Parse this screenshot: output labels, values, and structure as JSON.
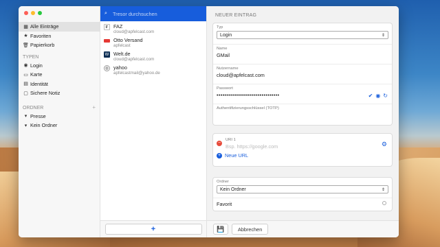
{
  "sidebar": {
    "main": [
      {
        "label": "Alle Einträge",
        "icon": "grid-icon"
      },
      {
        "label": "Favoriten",
        "icon": "star-icon"
      },
      {
        "label": "Papierkorb",
        "icon": "trash-icon"
      }
    ],
    "types_heading": "TYPEN",
    "types": [
      {
        "label": "Login",
        "icon": "globe-icon"
      },
      {
        "label": "Karte",
        "icon": "credit-card-icon"
      },
      {
        "label": "Identität",
        "icon": "id-card-icon"
      },
      {
        "label": "Sichere Notiz",
        "icon": "note-icon"
      }
    ],
    "folders_heading": "ORDNER",
    "folders": [
      {
        "label": "Presse"
      },
      {
        "label": "Kein Ordner"
      }
    ]
  },
  "search": {
    "placeholder": "Tresor durchsuchen"
  },
  "entries": [
    {
      "name": "FAZ",
      "sub": "cloud@apfelcast.com",
      "icon": "faz-favicon"
    },
    {
      "name": "Otto Versand",
      "sub": "apfelcast",
      "icon": "otto-favicon"
    },
    {
      "name": "Welt.de",
      "sub": "cloud@apfelcast.com",
      "icon": "welt-favicon"
    },
    {
      "name": "yahoo",
      "sub": "apfelcastmail@yahoo.de",
      "icon": "globe-icon"
    }
  ],
  "detail": {
    "title": "NEUER EINTRAG",
    "type_label": "Typ",
    "type_value": "Login",
    "name_label": "Name",
    "name_value": "GMail",
    "user_label": "Nutzername",
    "user_value": "cloud@apfelcast.com",
    "password_label": "Passwort",
    "password_value": "••••••••••••••••••••••••••••••••",
    "totp_label": "Authentifizierungsschlüssel (TOTP)",
    "uri_label": "URI 1",
    "uri_placeholder": "Bsp. https://google.com",
    "new_url": "Neue URL",
    "folder_label": "Ordner",
    "folder_value": "Kein Ordner",
    "favorite_label": "Favorit",
    "cancel": "Abbrechen"
  },
  "colors": {
    "accent": "#175ddc",
    "danger": "#e74c3c"
  }
}
